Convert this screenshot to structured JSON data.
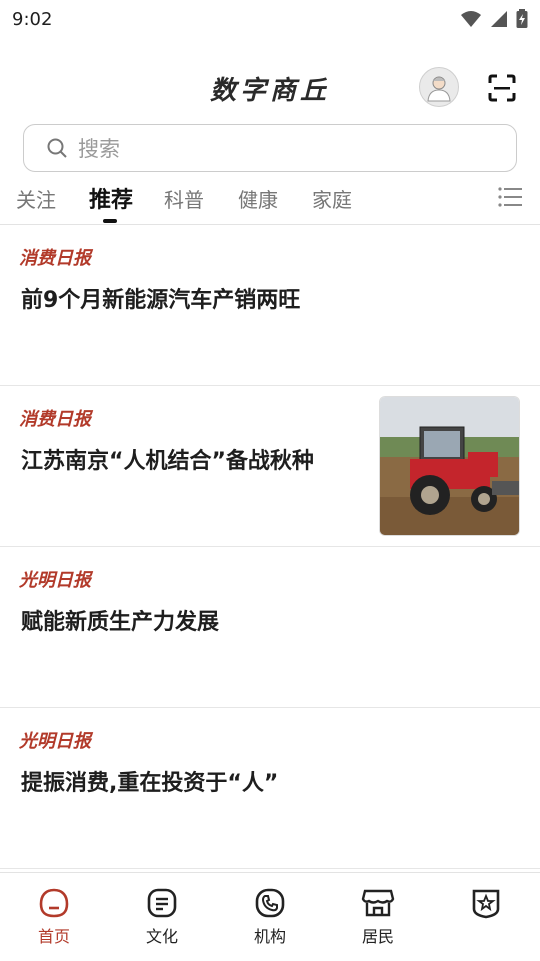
{
  "status": {
    "time": "9:02"
  },
  "header": {
    "title": "数字商丘"
  },
  "search": {
    "placeholder": "搜索"
  },
  "tabs": [
    {
      "label": "关注"
    },
    {
      "label": "推荐"
    },
    {
      "label": "科普"
    },
    {
      "label": "健康"
    },
    {
      "label": "家庭"
    }
  ],
  "articles": [
    {
      "source": "消费日报",
      "title": "前9个月新能源汽车产销两旺"
    },
    {
      "source": "消费日报",
      "title": "江苏南京“人机结合”备战秋种"
    },
    {
      "source": "光明日报",
      "title": "赋能新质生产力发展"
    },
    {
      "source": "光明日报",
      "title": "提振消费,重在投资于“人”"
    }
  ],
  "nav": [
    {
      "label": "首页"
    },
    {
      "label": "文化"
    },
    {
      "label": "机构"
    },
    {
      "label": "居民"
    }
  ],
  "colors": {
    "accent": "#b23a2a",
    "text": "#1f1f1f",
    "muted": "#777777"
  }
}
